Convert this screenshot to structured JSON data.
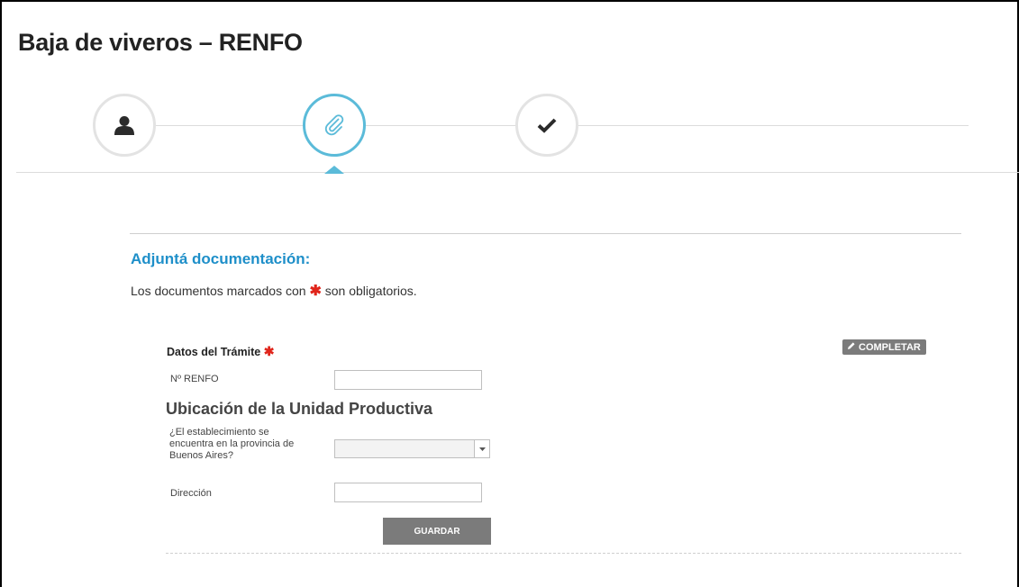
{
  "page": {
    "title": "Baja de viveros – RENFO"
  },
  "steps": [
    {
      "icon": "user-icon",
      "state": "done"
    },
    {
      "icon": "paperclip-icon",
      "state": "active"
    },
    {
      "icon": "checkmark-icon",
      "state": "pending"
    }
  ],
  "section": {
    "heading": "Adjuntá documentación:",
    "note_before": "Los documentos marcados con",
    "required_mark": "✱",
    "note_after": "son obligatorios."
  },
  "form": {
    "group_title": "Datos del Trámite",
    "complete_label": "COMPLETAR",
    "renfo_label": "Nº RENFO",
    "renfo_value": "",
    "subheading": "Ubicación de la Unidad Productiva",
    "province_question": "¿El establecimiento se encuentra en la provincia de Buenos Aires?",
    "province_value": "",
    "address_label": "Dirección",
    "address_value": "",
    "save_label": "GUARDAR"
  },
  "colors": {
    "accent": "#5bbbd9",
    "heading": "#1e8fc9",
    "required": "#e0251b",
    "button": "#7b7b7b"
  }
}
